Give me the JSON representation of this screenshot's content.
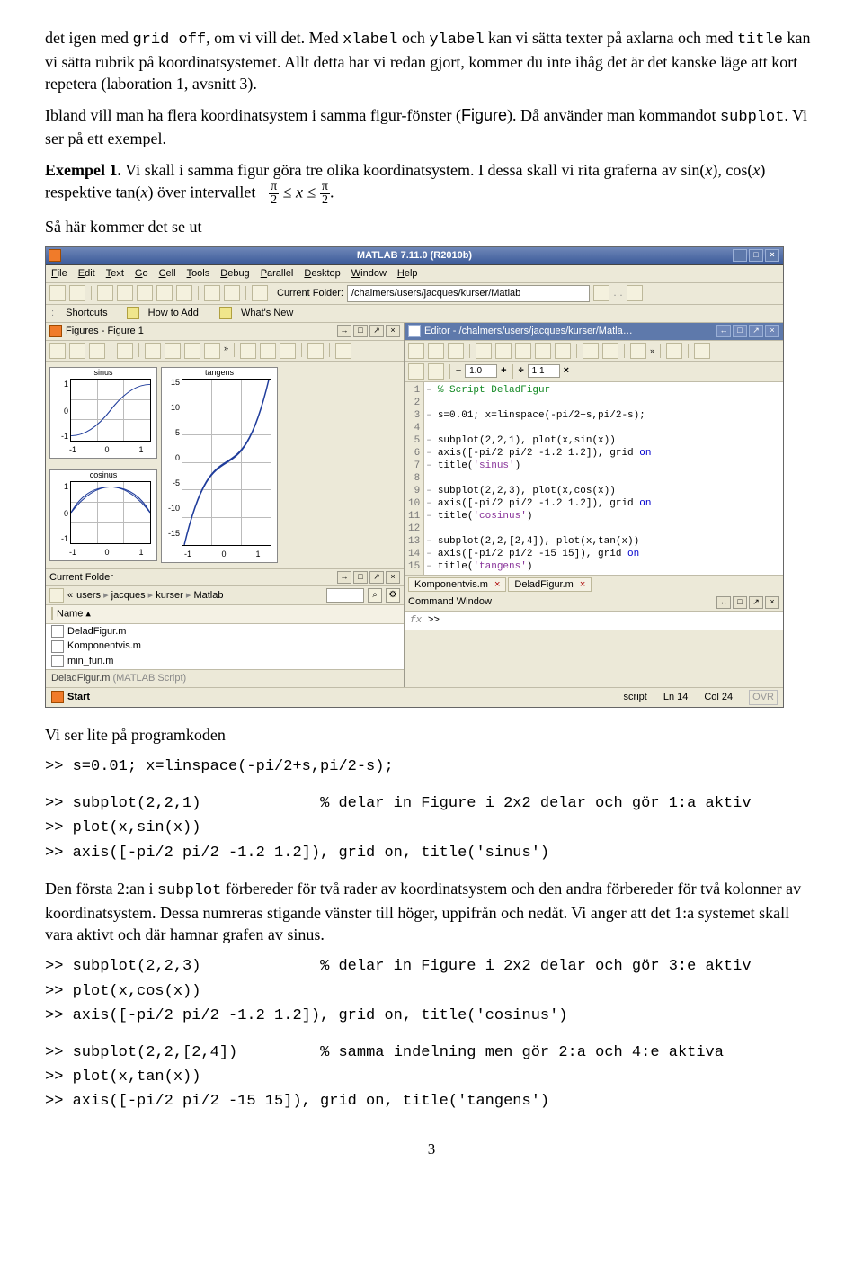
{
  "para1_a": "det igen med ",
  "para1_b": "grid off",
  "para1_c": ", om vi vill det. Med ",
  "para1_d": "xlabel",
  "para1_e": " och ",
  "para1_f": "ylabel",
  "para1_g": " kan vi sätta texter på axlarna och med ",
  "para1_h": "title",
  "para1_i": " kan vi sätta rubrik på koordinatsystemet. Allt detta har vi redan gjort, kommer du inte ihåg det är det kanske läge att kort repetera (laboration 1, avsnitt 3).",
  "para2_a": "Ibland vill man ha flera koordinatsystem i samma figur-fönster (",
  "para2_b": "Figure",
  "para2_c": "). Då använder man kommandot ",
  "para2_d": "subplot",
  "para2_e": ". Vi ser på ett exempel.",
  "ex_lead": "Exempel 1.",
  "ex_body_a": " Vi skall i samma figur göra tre olika koordinatsystem. I dessa skall vi rita graferna av sin(",
  "ex_body_b": "), cos(",
  "ex_body_c": ") respektive tan(",
  "ex_body_d": ") över intervallet −",
  "ex_body_e": " ≤ ",
  "ex_body_f": " ≤ ",
  "ex_body_g": ".",
  "so_line": "Så här kommer det se ut",
  "matlab": {
    "title": "MATLAB 7.11.0 (R2010b)",
    "menus": [
      "File",
      "Edit",
      "Text",
      "Go",
      "Cell",
      "Tools",
      "Debug",
      "Parallel",
      "Desktop",
      "Window",
      "Help"
    ],
    "cf_label": "Current Folder: ",
    "cf_path": "/chalmers/users/jacques/kurser/Matlab",
    "shortcuts_label": "Shortcuts",
    "sc_howto": "How to Add",
    "sc_whats": "What's New",
    "fig_title": "Figures - Figure 1",
    "plot_titles": [
      "sinus",
      "cosinus",
      "tangens"
    ],
    "yt_small": [
      "1",
      "0",
      "-1"
    ],
    "xt_small": [
      "-1",
      "0",
      "1"
    ],
    "yt_tall": [
      "15",
      "10",
      "5",
      "0",
      "-5",
      "-10",
      "-15"
    ],
    "xt_tall": [
      "-1",
      "0",
      "1"
    ],
    "cf_hdr": "Current Folder",
    "crumbs": [
      "users",
      "jacques",
      "kurser",
      "Matlab"
    ],
    "cf_name_hdr": "Name ▴",
    "cf_files": [
      "DeladFigur.m",
      "Komponentvis.m",
      "min_fun.m"
    ],
    "cf_foot_a": "DeladFigur.m ",
    "cf_foot_b": "(MATLAB Script)",
    "start": "Start",
    "editor_title": "Editor - /chalmers/users/jacques/kurser/Matla…",
    "ed_num1": "1.0",
    "ed_num2": "1.1",
    "code_lines": [
      "% Script DeladFigur",
      "",
      "s=0.01; x=linspace(-pi/2+s,pi/2-s);",
      "",
      "subplot(2,2,1), plot(x,sin(x))",
      "axis([-pi/2 pi/2 -1.2 1.2]), grid on",
      "title('sinus')",
      "",
      "subplot(2,2,3), plot(x,cos(x))",
      "axis([-pi/2 pi/2 -1.2 1.2]), grid on",
      "title('cosinus')",
      "",
      "subplot(2,2,[2,4]), plot(x,tan(x))",
      "axis([-pi/2 pi/2 -15 15]), grid on",
      "title('tangens')"
    ],
    "ed_tabs": [
      "Komponentvis.m",
      "DeladFigur.m"
    ],
    "cmdwin_title": "Command Window",
    "prompt": ">>",
    "status_script": "script",
    "status_ln": "Ln  14",
    "status_col": "Col  24",
    "status_ovr": "OVR"
  },
  "after_shot": "Vi ser lite på programkoden",
  "code1": ">> s=0.01; x=linspace(-pi/2+s,pi/2-s);",
  "code2_a": ">> subplot(2,2,1)",
  "code2_b": "% delar in Figure i 2x2 delar och gör 1:a aktiv",
  "code2_c": ">> plot(x,sin(x))",
  "code2_d": ">> axis([-pi/2 pi/2 -1.2 1.2]), grid on, title('sinus')",
  "para3_a": "Den första 2:an i ",
  "para3_b": "subplot",
  "para3_c": " förbereder för två rader av koordinatsystem och den andra förbereder för två kolonner av koordinatsystem. Dessa numreras stigande vänster till höger, uppifrån och nedåt. Vi anger att det 1:a systemet skall vara aktivt och där hamnar grafen av sinus.",
  "code3_a": ">> subplot(2,2,3)",
  "code3_b": "% delar in Figure i 2x2 delar och gör 3:e aktiv",
  "code3_c": ">> plot(x,cos(x))",
  "code3_d": ">> axis([-pi/2 pi/2 -1.2 1.2]), grid on, title('cosinus')",
  "code4_a": ">> subplot(2,2,[2,4])",
  "code4_b": "% samma indelning men gör 2:a och 4:e aktiva",
  "code4_c": ">> plot(x,tan(x))",
  "code4_d": ">> axis([-pi/2 pi/2 -15 15]), grid on, title('tangens')",
  "pageno": "3",
  "chart_data": [
    {
      "type": "line",
      "title": "sinus",
      "x_range": [
        -1.5708,
        1.5708
      ],
      "y_range": [
        -1.2,
        1.2
      ],
      "xticks": [
        -1,
        0,
        1
      ],
      "yticks": [
        -1,
        0,
        1
      ],
      "series": [
        {
          "name": "sin(x)",
          "fn": "sin"
        }
      ]
    },
    {
      "type": "line",
      "title": "cosinus",
      "x_range": [
        -1.5708,
        1.5708
      ],
      "y_range": [
        -1.2,
        1.2
      ],
      "xticks": [
        -1,
        0,
        1
      ],
      "yticks": [
        -1,
        0,
        1
      ],
      "series": [
        {
          "name": "cos(x)",
          "fn": "cos"
        }
      ]
    },
    {
      "type": "line",
      "title": "tangens",
      "x_range": [
        -1.5708,
        1.5708
      ],
      "y_range": [
        -15,
        15
      ],
      "xticks": [
        -1,
        0,
        1
      ],
      "yticks": [
        -15,
        -10,
        -5,
        0,
        5,
        10,
        15
      ],
      "series": [
        {
          "name": "tan(x)",
          "fn": "tan"
        }
      ]
    }
  ]
}
